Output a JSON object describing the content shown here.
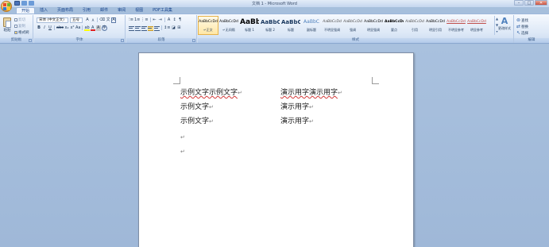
{
  "window": {
    "title": "文档 1 - Microsoft Word",
    "controls": {
      "minimize": "–",
      "maximize": "□",
      "close": "✕"
    }
  },
  "tabs": [
    {
      "label": "开始",
      "active": true
    },
    {
      "label": "插入"
    },
    {
      "label": "页面布局"
    },
    {
      "label": "引用"
    },
    {
      "label": "邮件"
    },
    {
      "label": "审阅"
    },
    {
      "label": "视图"
    },
    {
      "label": "PDF工具集"
    }
  ],
  "clipboard": {
    "paste_label": "粘贴",
    "cut_label": "剪切",
    "copy_label": "复制",
    "painter_label": "格式刷",
    "group_label": "剪贴板"
  },
  "font": {
    "name": "宋体 (中文正文)",
    "size": "五号",
    "group_label": "字体"
  },
  "paragraph": {
    "group_label": "段落"
  },
  "styles": {
    "group_label": "样式",
    "items": [
      {
        "sample": "AaBbCcDd",
        "name": "↵正文",
        "kind": "normal",
        "active": true
      },
      {
        "sample": "AaBbCcDd",
        "name": "↵无间隔",
        "kind": "normal"
      },
      {
        "sample": "AaBb",
        "name": "标题 1",
        "kind": "h1"
      },
      {
        "sample": "AaBbC",
        "name": "标题 2",
        "kind": "h2"
      },
      {
        "sample": "AaBbC",
        "name": "标题",
        "kind": "title"
      },
      {
        "sample": "AaBbC",
        "name": "副标题",
        "kind": "sub"
      },
      {
        "sample": "AaBbCcDd",
        "name": "不明显强调",
        "kind": "emph"
      },
      {
        "sample": "AaBbCcDd",
        "name": "强调",
        "kind": "emph"
      },
      {
        "sample": "AaBbCcDd",
        "name": "明显强调",
        "kind": "normal"
      },
      {
        "sample": "AaBbCcDd",
        "name": "要点",
        "kind": "strong"
      },
      {
        "sample": "AaBbCcDd",
        "name": "引用",
        "kind": "emph"
      },
      {
        "sample": "AaBbCcDd",
        "name": "明显引用",
        "kind": "normal"
      },
      {
        "sample": "AaBbCcDd",
        "name": "不明显参考",
        "kind": "ref"
      },
      {
        "sample": "AaBbCcDd",
        "name": "明显参考",
        "kind": "ref"
      }
    ],
    "change_label": "更改样式"
  },
  "editing": {
    "find_label": "查找",
    "replace_label": "替换",
    "select_label": "选择",
    "group_label": "编辑"
  },
  "doc": {
    "left_col": [
      "示例文字示例文字",
      "示例文字",
      "示例文字"
    ],
    "right_col": [
      "演示用字演示用字",
      "演示用字",
      "演示用字"
    ],
    "para_mark": "↵",
    "empty_marks": [
      "↵",
      "↵"
    ]
  }
}
